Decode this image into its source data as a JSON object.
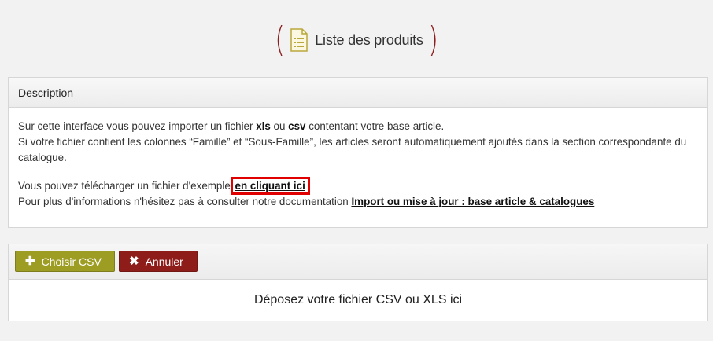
{
  "header": {
    "title": "Liste des produits",
    "icon": "document-list-icon",
    "accent_color": "#8b1f1f"
  },
  "description": {
    "heading": "Description",
    "line1_prefix": "Sur cette interface vous pouvez importer un fichier ",
    "line1_xls": "xls",
    "line1_mid": " ou ",
    "line1_csv": "csv",
    "line1_suffix": " contentant votre base article.",
    "line2": "Si votre fichier contient les colonnes “Famille” et “Sous-Famille”, les articles seront automatiquement ajoutés dans la section correspondante du catalogue.",
    "line3_prefix": "Vous pouvez télécharger un fichier d'exemple ",
    "example_link": "en cliquant ici",
    "line3_suffix": ".",
    "line4_prefix": "Pour plus d'informations n'hésitez pas à consulter notre documentation ",
    "doc_link": "Import ou mise à jour : base article & catalogues"
  },
  "upload": {
    "choose_label": "Choisir CSV",
    "choose_icon": "plus-icon",
    "cancel_label": "Annuler",
    "cancel_icon": "close-icon",
    "dropzone_text": "Déposez votre fichier CSV ou XLS ici",
    "choose_color": "#9d9d24",
    "cancel_color": "#8e1d1a"
  }
}
